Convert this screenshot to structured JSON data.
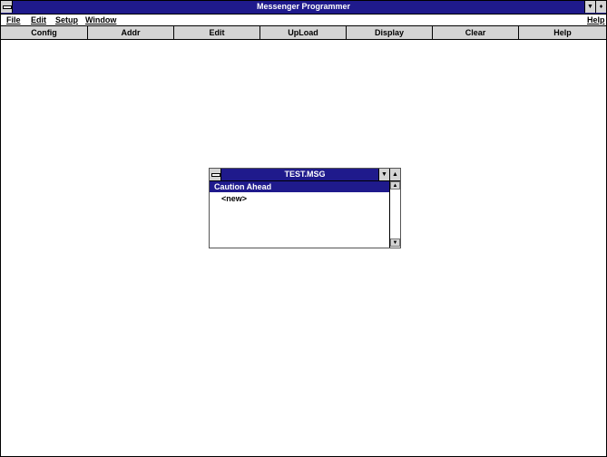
{
  "window": {
    "title": "Messenger Programmer",
    "minimize_glyph": "▼",
    "restore_glyph": "♦"
  },
  "menubar": {
    "items": [
      {
        "label": "File"
      },
      {
        "label": "Edit"
      },
      {
        "label": "Setup"
      },
      {
        "label": "Window"
      }
    ],
    "help": "Help"
  },
  "toolbar": {
    "buttons": [
      {
        "label": "Config"
      },
      {
        "label": "Addr"
      },
      {
        "label": "Edit"
      },
      {
        "label": "UpLoad"
      },
      {
        "label": "Display"
      },
      {
        "label": "Clear"
      },
      {
        "label": "Help"
      }
    ]
  },
  "child_window": {
    "title": "TEST.MSG",
    "minimize_glyph": "▼",
    "maximize_glyph": "▲",
    "items": [
      {
        "label": "Caution Ahead",
        "selected": true
      },
      {
        "label": "<new>",
        "selected": false
      }
    ],
    "scroll_up_glyph": "▲",
    "scroll_down_glyph": "▼"
  },
  "colors": {
    "titlebar": "#1f1a8c",
    "button_face": "#d4d4d4"
  }
}
